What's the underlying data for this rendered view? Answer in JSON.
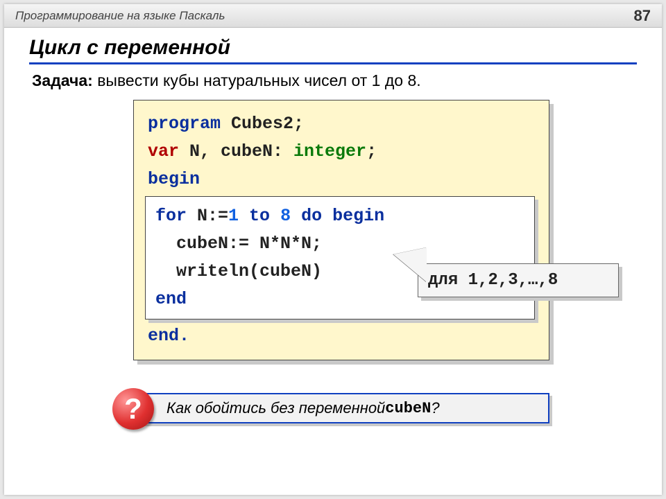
{
  "header": {
    "course_title": "Программирование на языке Паскаль",
    "page_number": "87"
  },
  "title": "Цикл с переменной",
  "task_label": "Задача:",
  "task_text": " вывести кубы натуральных чисел от 1 до 8.",
  "code": {
    "l1_kw": "program",
    "l1_name": " Cubes2;",
    "l2_kw": "var",
    "l2_vars": " N, cubeN: ",
    "l2_type": "integer",
    "l2_semi": ";",
    "l3_begin": "begin",
    "loop": {
      "l1_for": "for",
      "l1_mid1": " N:=",
      "l1_one": "1",
      "l1_to": " to ",
      "l1_eight": "8",
      "l1_do": " do begin",
      "l2": "  cubeN:= N*N*N;",
      "l3": "  writeln(cubeN)",
      "l4_end": "end"
    },
    "lend": "end."
  },
  "callout_text": "для 1,2,3,…,8",
  "question": {
    "badge": "?",
    "text_before": " Как обойтись без переменной ",
    "var": "cubeN",
    "text_after": "?"
  }
}
